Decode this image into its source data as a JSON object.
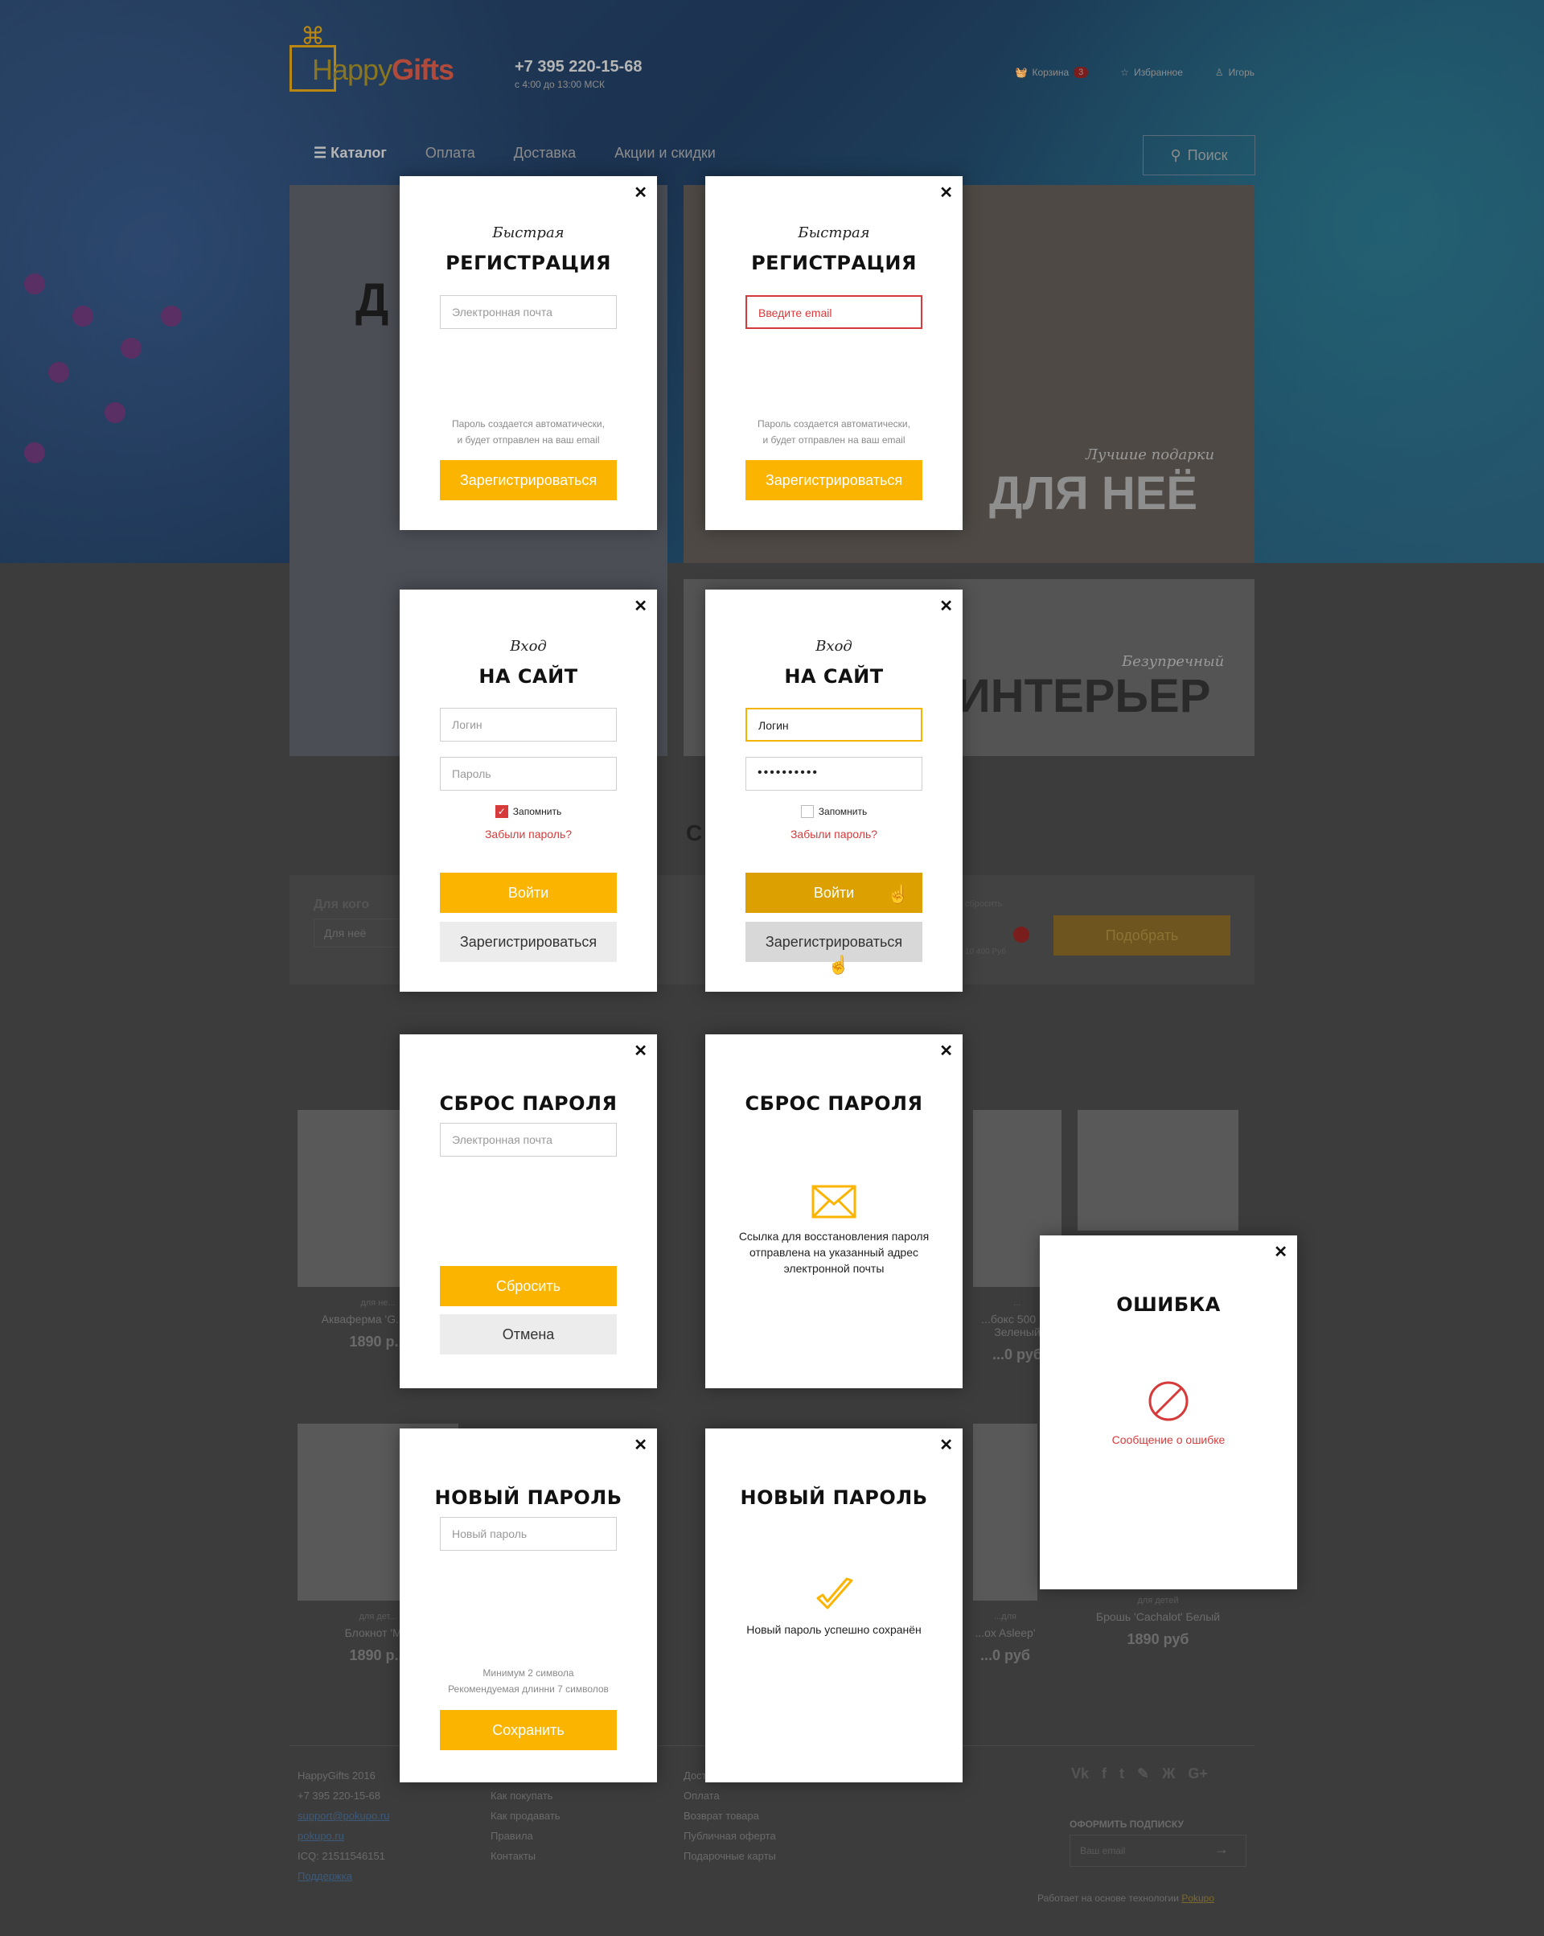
{
  "page": {
    "logo": {
      "text_a": "Happy",
      "text_b": "Gifts"
    },
    "phone": "+7 395 220-15-68",
    "hours": "с 4:00 до 13:00 МСК",
    "cart": {
      "label": "Корзина",
      "count": "3"
    },
    "favorites": "Избранное",
    "user": "Игорь",
    "nav": {
      "catalog": "Каталог",
      "items": [
        "Оплата",
        "Доставка",
        "Акции и скидки"
      ]
    },
    "search": "Поиск",
    "tiles": {
      "t1_big": "Д",
      "t2_italic": "Лучшие подарки",
      "t2_big": "ДЛЯ НЕЁ",
      "t3_italic": "Безупречный",
      "t3_big": "ИНТЕРЬЕР"
    },
    "filter": {
      "label": "Для кого",
      "value": "Для неё",
      "reset": "сбросить",
      "price": "10 400 Руб",
      "submit": "Подобрать",
      "heading_fragment": "С"
    },
    "products": [
      {
        "cat": "для не...",
        "name": "Акваферма 'G... Ver 3",
        "price": "1890 р..."
      },
      {
        "cat": "...",
        "name": "...бокс 500 мл Зеленый",
        "price": "...0 руб"
      },
      {
        "cat": "",
        "name": "",
        "price": ""
      },
      {
        "cat": "для дет...",
        "name": "Блокнот 'M...",
        "price": "1890 р..."
      },
      {
        "cat": "...для",
        "name": "...ox Asleep'",
        "price": "...0 руб"
      },
      {
        "cat": "для детей",
        "name": "Брошь 'Cachalot' Белый",
        "price": "1890 руб"
      }
    ],
    "footer": {
      "col1": [
        "HappyGifts 2016",
        "+7 395 220-15-68",
        "support@pokupo.ru",
        "pokupo.ru",
        "ICQ: 21511546151",
        "Поддержка"
      ],
      "col2": [
        "Как покупать",
        "Как продавать",
        "Правила",
        "Контакты"
      ],
      "col3": [
        "Дост...",
        "Оплата",
        "Возврат товара",
        "Публичная оферта",
        "Подарочные карты"
      ],
      "socials": [
        "Vk",
        "f",
        "t",
        "✎",
        "Ж",
        "G+"
      ],
      "subscribe": "ОФОРМИТЬ ПОДПИСКУ",
      "email_placeholder": "Ваш email",
      "powered": "Работает на основе технологии",
      "powered_link": "Pokupo"
    }
  },
  "modals": {
    "reg": {
      "subtitle": "Быстрая",
      "title": "РЕГИСТРАЦИЯ",
      "email_placeholder": "Электронная почта",
      "email_error": "Введите email",
      "hint_1": "Пароль создается автоматически,",
      "hint_2": "и будет отправлен на ваш email",
      "submit": "Зарегистрироваться"
    },
    "login": {
      "subtitle": "Вход",
      "title": "НА САЙТ",
      "login_placeholder": "Логин",
      "login_value": "Логин",
      "password_placeholder": "Пароль",
      "password_value": "••••••••••",
      "remember": "Запомнить",
      "forgot": "Забыли пароль?",
      "submit": "Войти",
      "register": "Зарегистрироваться"
    },
    "reset": {
      "title": "СБРОС ПАРОЛЯ",
      "email_placeholder": "Электронная почта",
      "submit": "Сбросить",
      "cancel": "Отмена",
      "success": "Ссылка для восстановления пароля отправлена на указанный адрес электронной почты"
    },
    "newpass": {
      "title": "НОВЫЙ ПАРОЛЬ",
      "placeholder": "Новый пароль",
      "hint_1": "Минимум 2 символа",
      "hint_2": "Рекомендуемая длинни 7 символов",
      "submit": "Сохранить",
      "success": "Новый пароль успешно сохранён"
    },
    "error": {
      "title": "ОШИБКА",
      "message": "Сообщение о ошибке"
    }
  },
  "colors": {
    "accent": "#fbb400",
    "error": "#d63a3a"
  },
  "icons": {
    "close": "close-icon",
    "envelope": "envelope-icon",
    "check": "check-icon",
    "error": "forbidden-icon",
    "cursor": "hand-cursor-icon"
  }
}
